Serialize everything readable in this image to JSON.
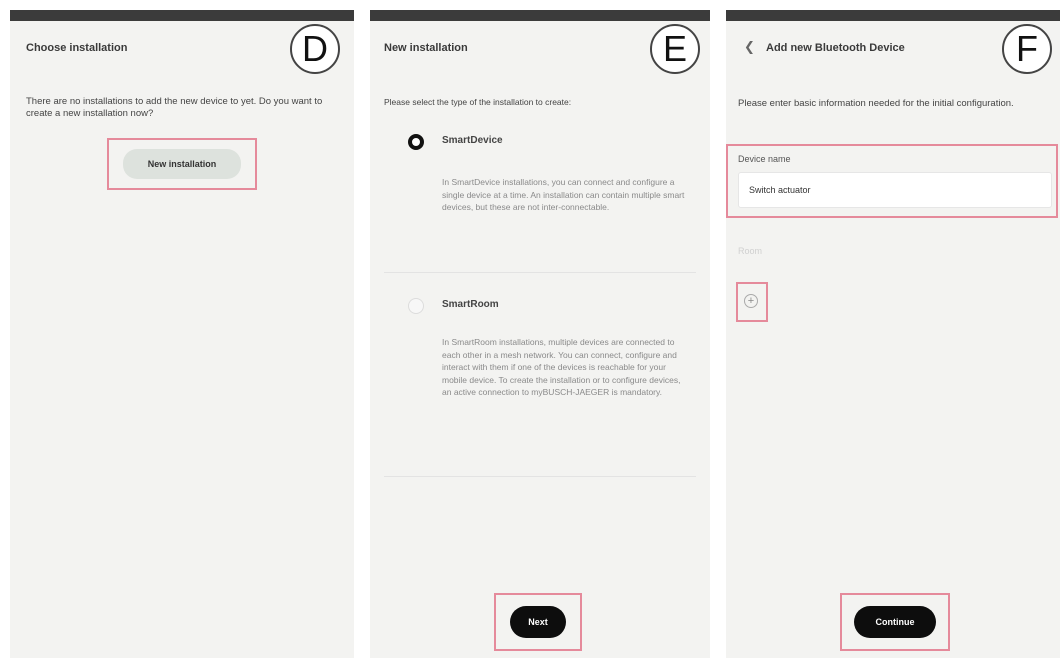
{
  "screen_d": {
    "badge": "D",
    "title": "Choose installation",
    "message": "There are no installations to add the new device to yet. Do you want to create a new installation now?",
    "new_installation_button": "New installation"
  },
  "screen_e": {
    "badge": "E",
    "title": "New installation",
    "instruction": "Please select the type of the installation to create:",
    "options": [
      {
        "label": "SmartDevice",
        "selected": true,
        "description": "In SmartDevice installations, you can connect and configure a single device at a time. An installation can contain multiple smart devices, but these are not inter-connectable."
      },
      {
        "label": "SmartRoom",
        "selected": false,
        "description": "In SmartRoom installations, multiple devices are connected to each other in a mesh network. You can connect, configure and interact with them if one of the devices is reachable for your mobile device. To create the installation or to configure devices, an active connection to myBUSCH-JAEGER is mandatory."
      }
    ],
    "next_button": "Next"
  },
  "screen_f": {
    "badge": "F",
    "title": "Add new Bluetooth Device",
    "instruction": "Please enter basic information needed for the initial configuration.",
    "device_name_label": "Device name",
    "device_name_value": "Switch actuator",
    "room_label": "Room",
    "add_room_icon": "plus-circle-icon",
    "continue_button": "Continue"
  },
  "colors": {
    "highlight": "#e58a9b",
    "panel_bg": "#f3f3f1",
    "primary_button": "#0d0d0d",
    "secondary_button": "#dde2dd"
  }
}
